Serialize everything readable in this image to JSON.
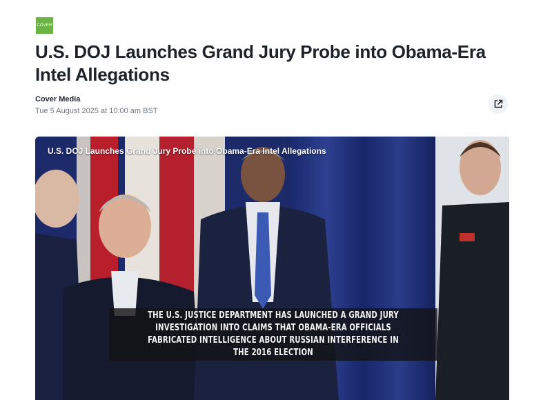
{
  "publisher": {
    "logo_text": "COVER",
    "logo_color": "#6ab344"
  },
  "article": {
    "title": "U.S. DOJ Launches Grand Jury Probe into Obama-Era Intel Allegations",
    "author": "Cover Media",
    "date": "Tue 5 August 2025 at 10:00 am BST"
  },
  "actions": {
    "share_icon": "external-link-icon"
  },
  "video": {
    "title": "U.S. DOJ Launches Grand Jury Probe into Obama-Era Intel Allegations",
    "caption": "The U.S. Justice Department has launched a grand jury investigation into claims that Obama-era officials fabricated intelligence about Russian interference in the 2016 election"
  }
}
